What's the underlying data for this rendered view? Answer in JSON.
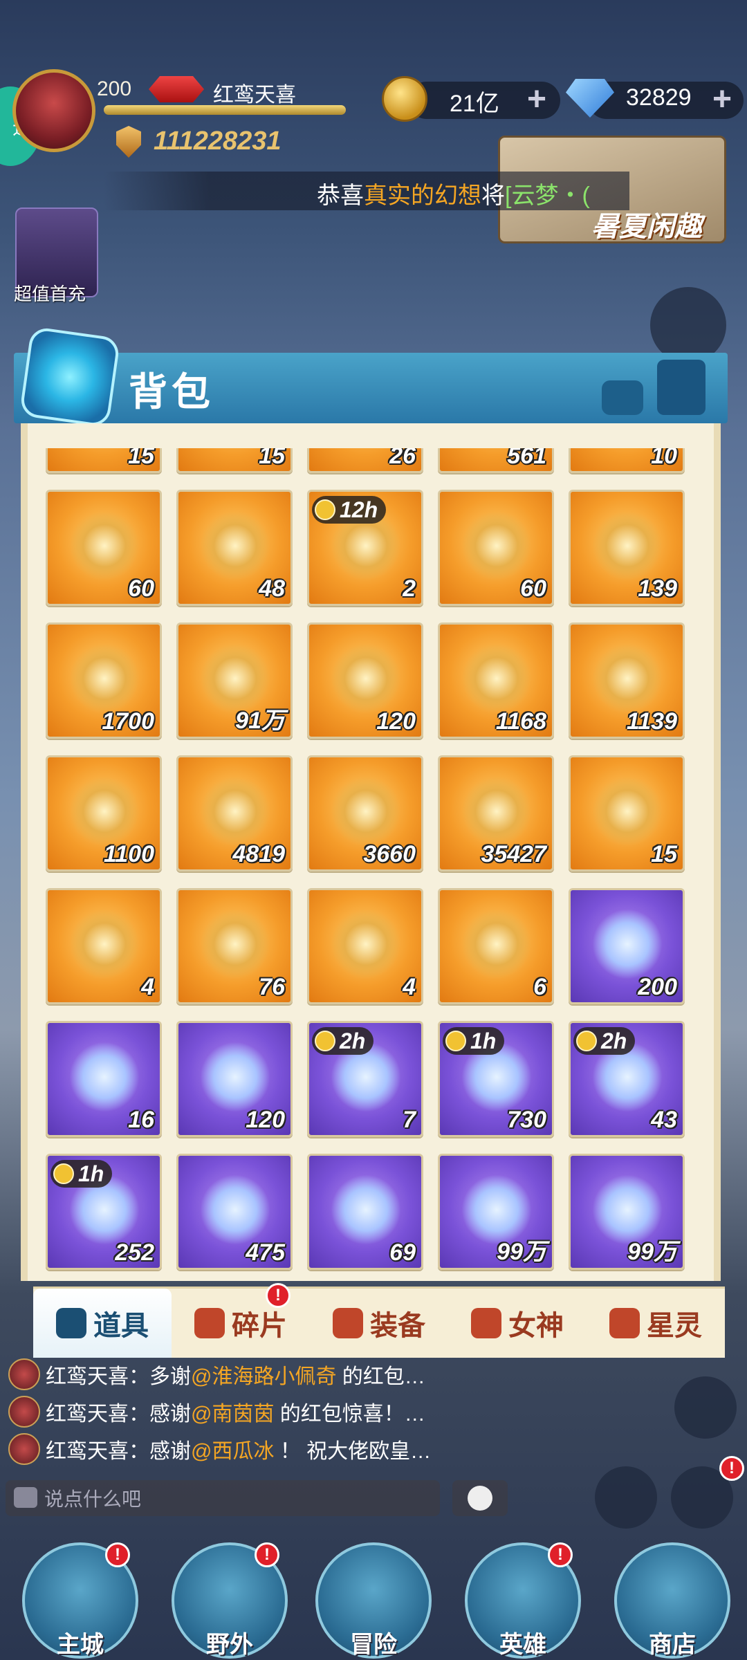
{
  "hud": {
    "speed": "速",
    "level": "200",
    "player_name": "红鸾天喜",
    "power": "111228231",
    "gold": "21亿",
    "diamonds": "32829",
    "plus": "+"
  },
  "ticker": {
    "prefix": "恭喜",
    "name": "真实的幻想",
    "mid": "将",
    "item": "[云梦・("
  },
  "banners": {
    "summer": "暑夏闲趣",
    "first_recharge": "超值首充"
  },
  "bag": {
    "title": "背包",
    "top_partial": [
      "15",
      "15",
      "26",
      "561",
      "10"
    ],
    "items": [
      {
        "qty": "60",
        "rarity": "orange",
        "timer": ""
      },
      {
        "qty": "48",
        "rarity": "orange",
        "timer": ""
      },
      {
        "qty": "2",
        "rarity": "orange",
        "timer": "12h"
      },
      {
        "qty": "60",
        "rarity": "orange",
        "timer": ""
      },
      {
        "qty": "139",
        "rarity": "orange",
        "timer": ""
      },
      {
        "qty": "1700",
        "rarity": "orange",
        "timer": ""
      },
      {
        "qty": "91万",
        "rarity": "orange",
        "timer": ""
      },
      {
        "qty": "120",
        "rarity": "orange",
        "timer": ""
      },
      {
        "qty": "1168",
        "rarity": "orange",
        "timer": ""
      },
      {
        "qty": "1139",
        "rarity": "orange",
        "timer": ""
      },
      {
        "qty": "1100",
        "rarity": "orange",
        "timer": ""
      },
      {
        "qty": "4819",
        "rarity": "orange",
        "timer": ""
      },
      {
        "qty": "3660",
        "rarity": "orange",
        "timer": ""
      },
      {
        "qty": "35427",
        "rarity": "orange",
        "timer": ""
      },
      {
        "qty": "15",
        "rarity": "orange",
        "timer": ""
      },
      {
        "qty": "4",
        "rarity": "orange",
        "timer": ""
      },
      {
        "qty": "76",
        "rarity": "orange",
        "timer": ""
      },
      {
        "qty": "4",
        "rarity": "orange",
        "timer": ""
      },
      {
        "qty": "6",
        "rarity": "orange",
        "timer": ""
      },
      {
        "qty": "200",
        "rarity": "purple",
        "timer": ""
      },
      {
        "qty": "16",
        "rarity": "purple",
        "timer": ""
      },
      {
        "qty": "120",
        "rarity": "purple",
        "timer": ""
      },
      {
        "qty": "7",
        "rarity": "purple",
        "timer": "2h"
      },
      {
        "qty": "730",
        "rarity": "purple",
        "timer": "1h"
      },
      {
        "qty": "43",
        "rarity": "purple",
        "timer": "2h"
      },
      {
        "qty": "252",
        "rarity": "purple",
        "timer": "1h"
      },
      {
        "qty": "475",
        "rarity": "purple",
        "timer": ""
      },
      {
        "qty": "69",
        "rarity": "purple",
        "timer": ""
      },
      {
        "qty": "99万",
        "rarity": "purple",
        "timer": ""
      },
      {
        "qty": "99万",
        "rarity": "purple",
        "timer": ""
      }
    ],
    "tabs": [
      {
        "label": "道具",
        "active": true,
        "badge": ""
      },
      {
        "label": "碎片",
        "active": false,
        "badge": "!"
      },
      {
        "label": "装备",
        "active": false,
        "badge": ""
      },
      {
        "label": "女神",
        "active": false,
        "badge": ""
      },
      {
        "label": "星灵",
        "active": false,
        "badge": ""
      }
    ]
  },
  "chat": {
    "lines": [
      {
        "sender": "红鸾天喜：",
        "pre": "多谢",
        "mention": "@淮海路小佩奇",
        "post": " 的红包…"
      },
      {
        "sender": "红鸾天喜：",
        "pre": "感谢",
        "mention": "@南茵茵",
        "post": " 的红包惊喜！…"
      },
      {
        "sender": "红鸾天喜：",
        "pre": "感谢",
        "mention": "@西瓜冰",
        "post": " ！ 祝大佬欧皇…"
      }
    ],
    "placeholder": "说点什么吧"
  },
  "nav": [
    {
      "label": "主城",
      "badge": "!"
    },
    {
      "label": "野外",
      "badge": "!"
    },
    {
      "label": "冒险",
      "badge": ""
    },
    {
      "label": "英雄",
      "badge": "!"
    },
    {
      "label": "商店",
      "badge": ""
    }
  ],
  "colors": {
    "orange_slot": "#f59c2a",
    "purple_slot": "#7a52d8",
    "accent": "#2a78a8",
    "highlight": "#f5a623"
  }
}
